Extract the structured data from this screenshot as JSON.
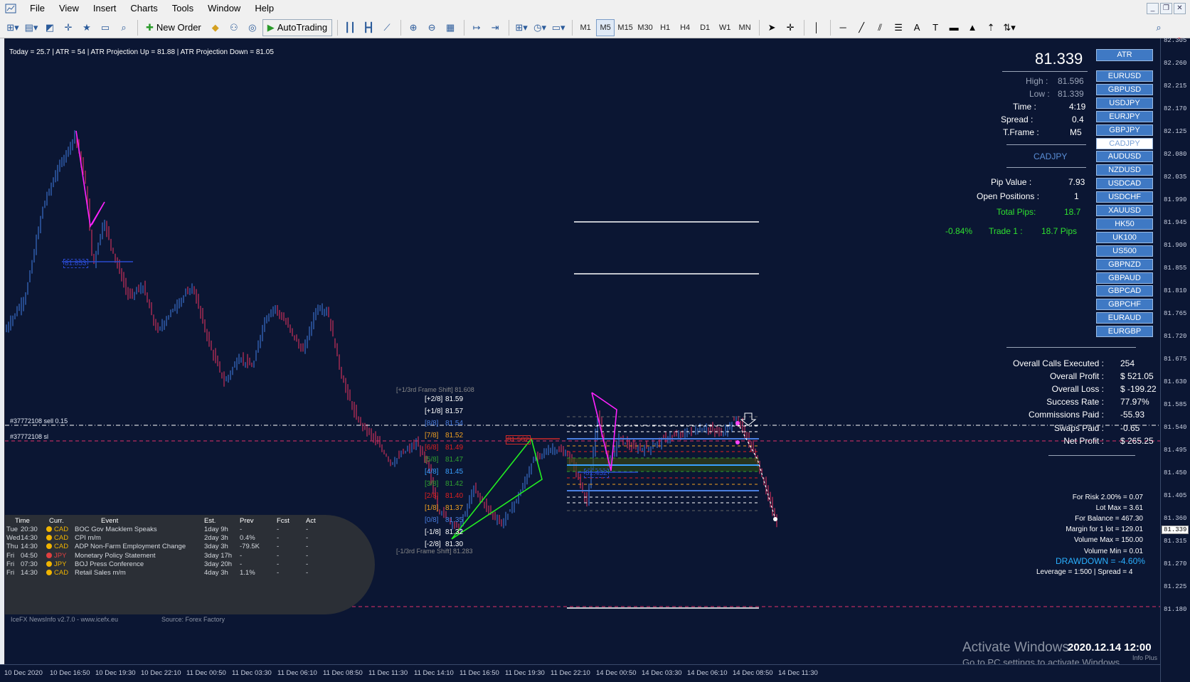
{
  "menu": [
    "File",
    "View",
    "Insert",
    "Charts",
    "Tools",
    "Window",
    "Help"
  ],
  "toolbar": {
    "new_order": "New Order",
    "autotrading": "AutoTrading",
    "timeframes": [
      "M1",
      "M5",
      "M15",
      "M30",
      "H1",
      "H4",
      "D1",
      "W1",
      "MN"
    ],
    "active_tf": "M5",
    "notifications": "2"
  },
  "info_bar": "Today = 25.7    |    ATR = 54    |    ATR Projection Up = 81.88    |    ATR Projection Down = 81.05",
  "panel": {
    "price": "81.339",
    "atr_button": "ATR",
    "high_label": "High :",
    "high": "81.596",
    "low_label": "Low :",
    "low": "81.339",
    "time_label": "Time :",
    "time": "4:19",
    "spread_label": "Spread :",
    "spread": "0.4",
    "tframe_label": "T.Frame :",
    "tframe": "M5",
    "symbol": "CADJPY",
    "pip_value_label": "Pip Value :",
    "pip_value": "7.93",
    "open_positions_label": "Open Positions :",
    "open_positions": "1",
    "total_pips_label": "Total Pips:",
    "total_pips": "18.7",
    "pct": "-0.84%",
    "trade_label": "Trade 1 :",
    "trade_pips": "18.7 Pips",
    "symbols": [
      "EURUSD",
      "GBPUSD",
      "USDJPY",
      "EURJPY",
      "GBPJPY",
      "CADJPY",
      "AUDUSD",
      "NZDUSD",
      "USDCAD",
      "USDCHF",
      "XAUUSD",
      "HK50",
      "UK100",
      "US500",
      "GBPNZD",
      "GBPAUD",
      "GBPCAD",
      "GBPCHF",
      "EURAUD",
      "EURGBP"
    ],
    "selected_symbol": "CADJPY",
    "stats": [
      {
        "label": "Overall Calls Executed :",
        "value": "254"
      },
      {
        "label": "Overall Profit :",
        "value": "$ 521.05"
      },
      {
        "label": "Overall Loss :",
        "value": "$ -199.22"
      },
      {
        "label": "Success Rate :",
        "value": "77.97%"
      },
      {
        "label": "Commissions Paid :",
        "value": "-55.93"
      },
      {
        "label": "Swaps Paid :",
        "value": "-0.65"
      },
      {
        "label": "Net Profit :",
        "value": "$ 265.25"
      }
    ],
    "risk": [
      "For Risk 2.00% = 0.07",
      "Lot Max = 3.61",
      "For Balance = 467.30",
      "Margin for 1 lot = 129.01",
      "Volume Max = 150.00",
      "Volume Min = 0.01"
    ],
    "drawdown": "DRAWDOWN = -4.60%",
    "leverage": "Leverage = 1:500 | Spread = 4"
  },
  "orders": {
    "sell": "#37772108 sell 0.15",
    "sl": "#37772108 sl"
  },
  "murrey": {
    "top_shift": "[+1/3rd Frame Shift]  81.608",
    "bottom_shift": "[-1/3rd Frame Shift]  81.283",
    "levels": [
      {
        "tag": "[+2/8]",
        "price": "81.59",
        "color": "#ffffff"
      },
      {
        "tag": "[+1/8]",
        "price": "81.57",
        "color": "#ffffff"
      },
      {
        "tag": "[8/8]",
        "price": "81.54",
        "color": "#4a7ee0"
      },
      {
        "tag": "[7/8]",
        "price": "81.52",
        "color": "#f0a020"
      },
      {
        "tag": "[6/8]",
        "price": "81.49",
        "color": "#e02020"
      },
      {
        "tag": "[5/8]",
        "price": "81.47",
        "color": "#30a030"
      },
      {
        "tag": "[4/8]",
        "price": "81.45",
        "color": "#3aa0ff"
      },
      {
        "tag": "[3/8]",
        "price": "81.42",
        "color": "#30a030"
      },
      {
        "tag": "[2/8]",
        "price": "81.40",
        "color": "#e02020"
      },
      {
        "tag": "[1/8]",
        "price": "81.37",
        "color": "#f0a020"
      },
      {
        "tag": "[0/8]",
        "price": "81.35",
        "color": "#4a7ee0"
      },
      {
        "tag": "[-1/8]",
        "price": "81.32",
        "color": "#ffffff"
      },
      {
        "tag": "[-2/8]",
        "price": "81.30",
        "color": "#ffffff"
      }
    ]
  },
  "pattern_labels": {
    "a": "81.853",
    "b": "81.502",
    "c": "81.432"
  },
  "news": {
    "headers": [
      "Time",
      "Curr.",
      "Event",
      "Est.",
      "Prev",
      "Fcst",
      "Act"
    ],
    "rows": [
      {
        "day": "Tue",
        "time": "20:30",
        "curr": "CAD",
        "color": "#f0b400",
        "event": "BOC Gov Macklem Speaks",
        "est": "1day 9h",
        "prev": "-",
        "fcst": "-",
        "act": "-"
      },
      {
        "day": "Wed",
        "time": "14:30",
        "curr": "CAD",
        "color": "#f0b400",
        "event": "CPI m/m",
        "est": "2day 3h",
        "prev": "0.4%",
        "fcst": "-",
        "act": "-"
      },
      {
        "day": "Thu",
        "time": "14:30",
        "curr": "CAD",
        "color": "#f0b400",
        "event": "ADP Non-Farm Employment Change",
        "est": "3day 3h",
        "prev": "-79.5K",
        "fcst": "-",
        "act": "-"
      },
      {
        "day": "Fri",
        "time": "04:50",
        "curr": "JPY",
        "color": "#e04040",
        "event": "Monetary Policy Statement",
        "est": "3day 17h",
        "prev": "-",
        "fcst": "-",
        "act": "-"
      },
      {
        "day": "Fri",
        "time": "07:30",
        "curr": "JPY",
        "color": "#f0b400",
        "event": "BOJ Press Conference",
        "est": "3day 20h",
        "prev": "-",
        "fcst": "-",
        "act": "-"
      },
      {
        "day": "Fri",
        "time": "14:30",
        "curr": "CAD",
        "color": "#f0b400",
        "event": "Retail Sales m/m",
        "est": "4day 3h",
        "prev": "1.1%",
        "fcst": "-",
        "act": "-"
      }
    ],
    "footer": "IceFX NewsInfo v2.7.0  -  www.icefx.eu",
    "source": "Source: Forex Factory"
  },
  "price_ticks": [
    "82.305",
    "82.260",
    "82.215",
    "82.170",
    "82.125",
    "82.080",
    "82.035",
    "81.990",
    "81.945",
    "81.900",
    "81.855",
    "81.810",
    "81.765",
    "81.720",
    "81.675",
    "81.630",
    "81.585",
    "81.540",
    "81.495",
    "81.450",
    "81.405",
    "81.360",
    "81.339",
    "81.315",
    "81.270",
    "81.225",
    "81.180"
  ],
  "current_tick": "81.339",
  "time_ticks": [
    "10 Dec 2020",
    "10 Dec 16:50",
    "10 Dec 19:30",
    "10 Dec 22:10",
    "11 Dec 00:50",
    "11 Dec 03:30",
    "11 Dec 06:10",
    "11 Dec 08:50",
    "11 Dec 11:30",
    "11 Dec 14:10",
    "11 Dec 16:50",
    "11 Dec 19:30",
    "11 Dec 22:10",
    "14 Dec 00:50",
    "14 Dec 03:30",
    "14 Dec 06:10",
    "14 Dec 08:50",
    "14 Dec 11:30"
  ],
  "datestamp": "2020.12.14 12:00",
  "watermark": {
    "line1": "Activate Windows",
    "line2": "Go to PC settings to activate Windows."
  },
  "info_plus": "Info Plus",
  "colors": {
    "background": "#0b1633",
    "bull": "#3a6ec8",
    "bear": "#c8305a",
    "pattern1": "#ff22ff",
    "pattern2": "#22ee22"
  }
}
